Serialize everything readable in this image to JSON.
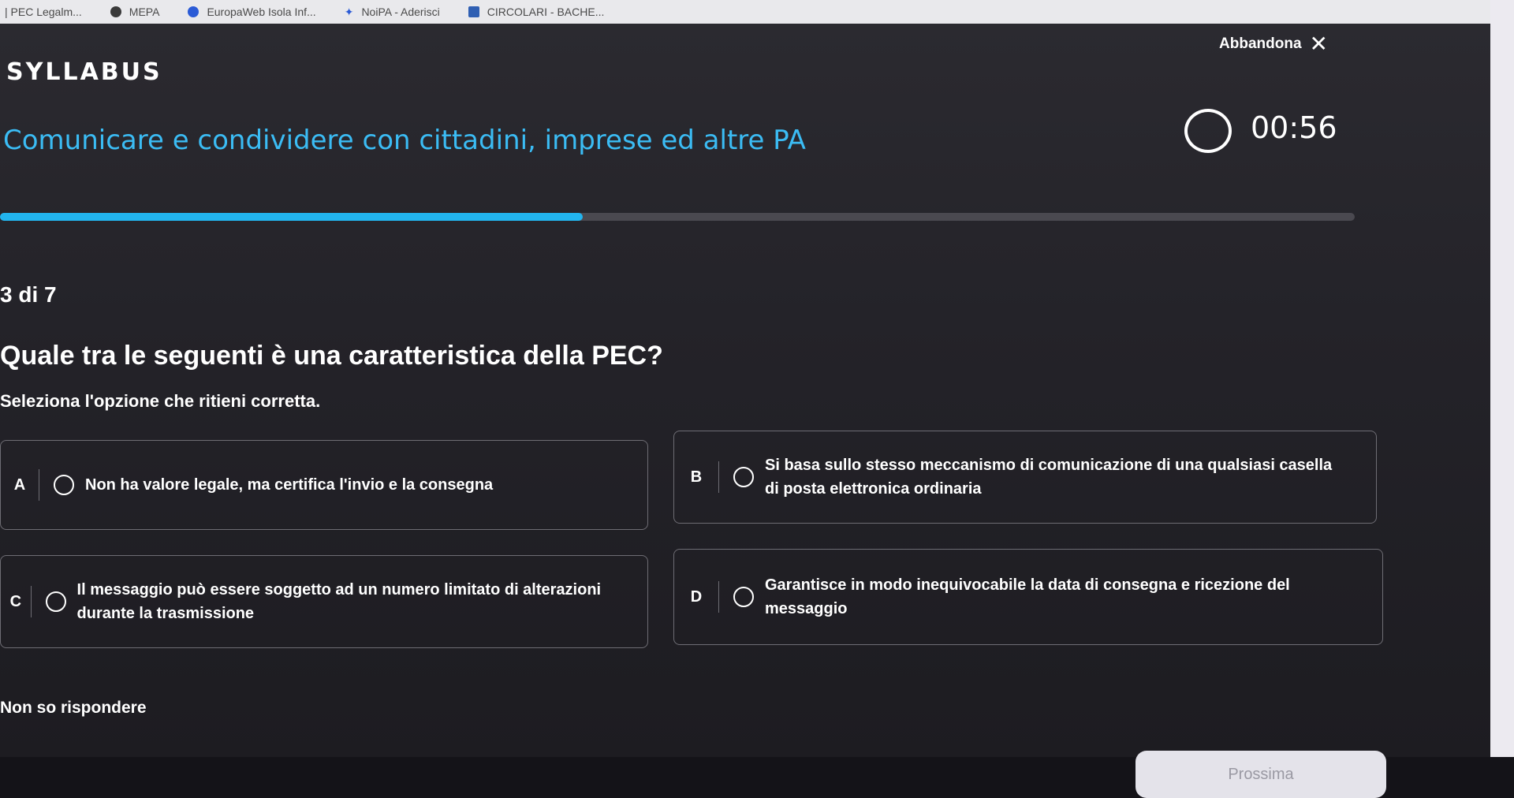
{
  "bookmarks": [
    {
      "label": "| PEC Legalm...",
      "icon": "none"
    },
    {
      "label": "MEPA",
      "icon": "globe-icon"
    },
    {
      "label": "EuropaWeb Isola Inf...",
      "icon": "globe-icon"
    },
    {
      "label": "NoiPA - Aderisci",
      "icon": "star-icon"
    },
    {
      "label": "CIRCOLARI - BACHE...",
      "icon": "doc-icon"
    }
  ],
  "header": {
    "logo": "SYLLABUS",
    "abandon_label": "Abbandona",
    "close_glyph": "✕"
  },
  "course_title": "Comunicare e condividere con cittadini, imprese ed altre PA",
  "timer": {
    "value": "00:56"
  },
  "progress": {
    "fraction": 0.43
  },
  "question": {
    "counter": "3 di 7",
    "text": "Quale tra le seguenti è una caratteristica della PEC?",
    "hint": "Seleziona l'opzione che ritieni corretta."
  },
  "options": [
    {
      "letter": "A",
      "text": "Non ha valore legale, ma certifica l'invio e la consegna"
    },
    {
      "letter": "B",
      "text": "Si basa sullo stesso meccanismo di comunicazione di una qualsiasi casella di posta elettronica ordinaria"
    },
    {
      "letter": "C",
      "text": "Il messaggio può essere soggetto ad un numero limitato di alterazioni durante la trasmissione"
    },
    {
      "letter": "D",
      "text": "Garantisce in modo inequivocabile la data di consegna e ricezione del messaggio"
    }
  ],
  "dont_know_label": "Non so rispondere",
  "next_label": "Prossima",
  "colors": {
    "accent": "#22b5ef",
    "title": "#3bbcf4",
    "background": "#242329"
  }
}
